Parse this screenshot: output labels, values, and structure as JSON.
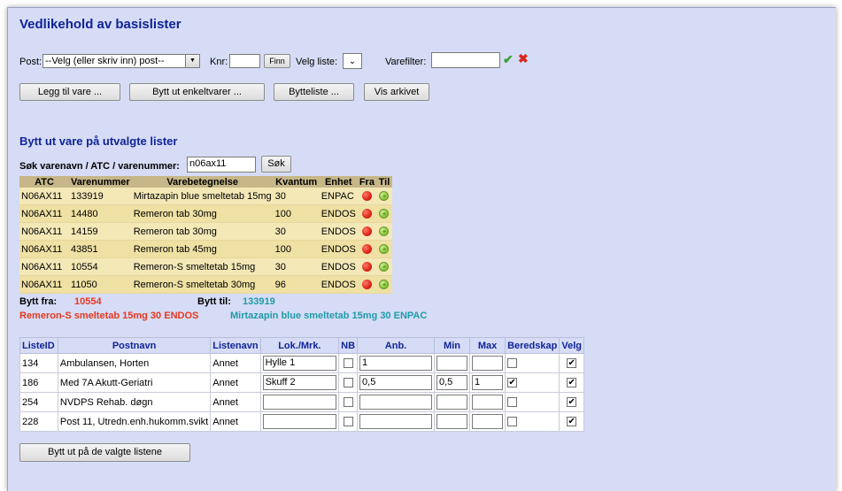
{
  "page_title": "Vedlikehold av basislister",
  "filters": {
    "post_label": "Post:",
    "post_value": "--Velg (eller skriv inn) post--",
    "knr_label": "Knr:",
    "knr_value": "",
    "finn_label": "Finn",
    "velg_liste_label": "Velg liste:",
    "varefilter_label": "Varefilter:",
    "varefilter_value": ""
  },
  "buttons": {
    "legg_til": "Legg til vare ...",
    "bytt_ut": "Bytt ut enkeltvarer ...",
    "bytteliste": "Bytteliste ...",
    "vis_arkivet": "Vis arkivet"
  },
  "section_title": "Bytt ut vare på utvalgte lister",
  "search": {
    "label": "Søk varenavn / ATC / varenummer:",
    "value": "n06ax11",
    "button": "Søk"
  },
  "results": {
    "headers": [
      "ATC",
      "Varenummer",
      "Varebetegnelse",
      "Kvantum",
      "Enhet",
      "Fra",
      "Til"
    ],
    "rows": [
      {
        "atc": "N06AX11",
        "varenr": "133919",
        "navn": "Mirtazapin blue smeltetab 15mg",
        "kvantum": "30",
        "enhet": "ENPAC"
      },
      {
        "atc": "N06AX11",
        "varenr": "14480",
        "navn": "Remeron tab 30mg",
        "kvantum": "100",
        "enhet": "ENDOS"
      },
      {
        "atc": "N06AX11",
        "varenr": "14159",
        "navn": "Remeron tab 30mg",
        "kvantum": "30",
        "enhet": "ENDOS"
      },
      {
        "atc": "N06AX11",
        "varenr": "43851",
        "navn": "Remeron tab 45mg",
        "kvantum": "100",
        "enhet": "ENDOS"
      },
      {
        "atc": "N06AX11",
        "varenr": "10554",
        "navn": "Remeron-S smeltetab 15mg",
        "kvantum": "30",
        "enhet": "ENDOS"
      },
      {
        "atc": "N06AX11",
        "varenr": "11050",
        "navn": "Remeron-S smeltetab 30mg",
        "kvantum": "96",
        "enhet": "ENDOS"
      }
    ]
  },
  "swap": {
    "fra_label": "Bytt fra:",
    "fra_nr": "10554",
    "fra_desc": "Remeron-S smeltetab 15mg 30 ENDOS",
    "til_label": "Bytt til:",
    "til_nr": "133919",
    "til_desc": "Mirtazapin blue smeltetab 15mg 30 ENPAC",
    "fra_color": "#e8361e",
    "til_color": "#1f9ba8"
  },
  "lists": {
    "headers": [
      "ListeID",
      "Postnavn",
      "Listenavn",
      "Lok./Mrk.",
      "NB",
      "Anb.",
      "Min",
      "Max",
      "Beredskap",
      "Velg"
    ],
    "rows": [
      {
        "id": "134",
        "postnavn": "Ambulansen, Horten",
        "listenavn": "Annet",
        "lok": "Hylle 1",
        "nb": false,
        "anb": "1",
        "min": "",
        "max": "",
        "beredskap": false,
        "velg": true
      },
      {
        "id": "186",
        "postnavn": "Med 7A Akutt-Geriatri",
        "listenavn": "Annet",
        "lok": "Skuff 2",
        "nb": false,
        "anb": "0,5",
        "min": "0,5",
        "max": "1",
        "beredskap": true,
        "velg": true
      },
      {
        "id": "254",
        "postnavn": "NVDPS Rehab. døgn",
        "listenavn": "Annet",
        "lok": "",
        "nb": false,
        "anb": "",
        "min": "",
        "max": "",
        "beredskap": false,
        "velg": true
      },
      {
        "id": "228",
        "postnavn": "Post 11, Utredn.enh.hukomm.svikt",
        "listenavn": "Annet",
        "lok": "",
        "nb": false,
        "anb": "",
        "min": "",
        "max": "",
        "beredskap": false,
        "velg": true
      }
    ]
  },
  "submit_label": "Bytt ut på de valgte listene"
}
